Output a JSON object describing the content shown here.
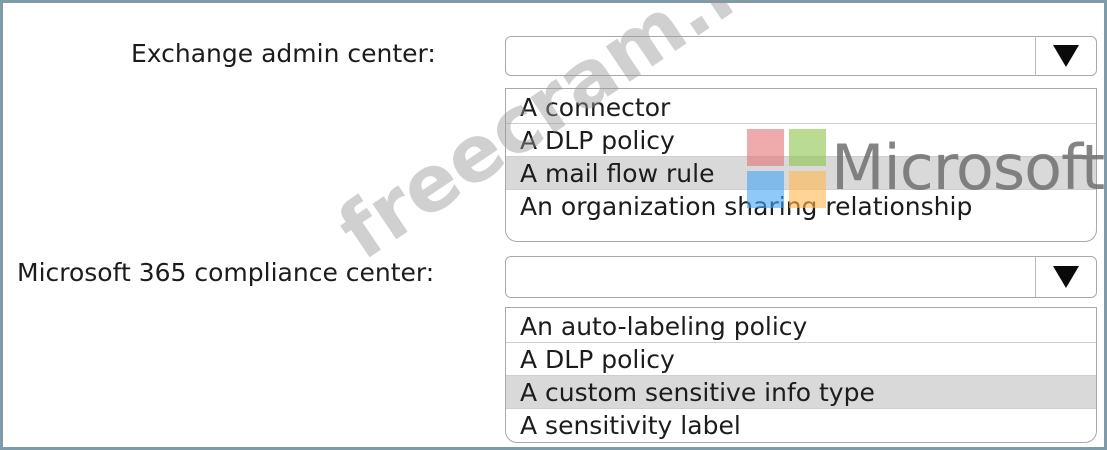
{
  "sections": [
    {
      "label": "Exchange admin center:",
      "options": [
        "A connector",
        "A DLP policy",
        "A mail flow rule",
        "An organization sharing relationship"
      ],
      "selected_index": 2
    },
    {
      "label": "Microsoft 365 compliance center:",
      "options": [
        "An auto-labeling policy",
        "A DLP policy",
        "A custom sensitive info type",
        "A sensitivity label"
      ],
      "selected_index": 2
    }
  ],
  "watermark": {
    "site": "freecram.net",
    "brand": "Microsoft"
  },
  "colors": {
    "frame": "#7f9aa8",
    "selected_bg": "#d9d9d9",
    "logo": [
      "#e57373",
      "#8bc34a",
      "#42a5f5",
      "#ffb74d"
    ]
  },
  "icons": {
    "dropdown": "triangle-down-icon"
  }
}
